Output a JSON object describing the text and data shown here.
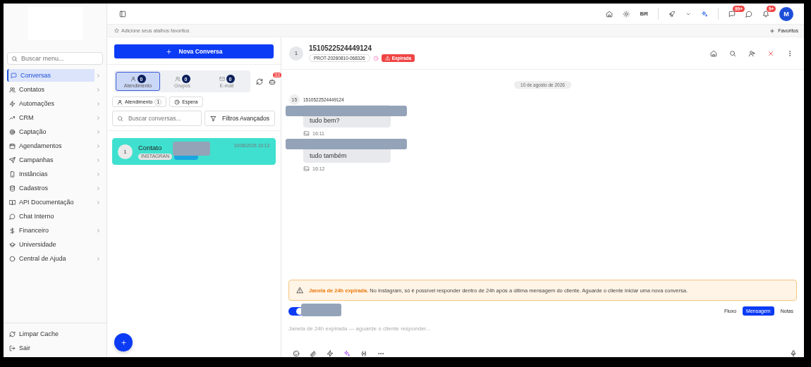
{
  "sidebar": {
    "search_placeholder": "Buscar menu...",
    "items": [
      {
        "label": "Conversas",
        "has_submenu": true,
        "selected": true
      },
      {
        "label": "Contatos",
        "has_submenu": true,
        "selected": false
      },
      {
        "label": "Automações",
        "has_submenu": true,
        "selected": false
      },
      {
        "label": "CRM",
        "has_submenu": true,
        "selected": false
      },
      {
        "label": "Captação",
        "has_submenu": true,
        "selected": false
      },
      {
        "label": "Agendamentos",
        "has_submenu": true,
        "selected": false
      },
      {
        "label": "Campanhas",
        "has_submenu": true,
        "selected": false
      },
      {
        "label": "Instâncias",
        "has_submenu": true,
        "selected": false
      },
      {
        "label": "Cadastros",
        "has_submenu": true,
        "selected": false
      },
      {
        "label": "API Documentação",
        "has_submenu": true,
        "selected": false
      },
      {
        "label": "Chat Interno",
        "has_submenu": false,
        "selected": false
      },
      {
        "label": "Financeiro",
        "has_submenu": true,
        "selected": false
      },
      {
        "label": "Universidade",
        "has_submenu": false,
        "selected": false
      },
      {
        "label": "Central de Ajuda",
        "has_submenu": true,
        "selected": false
      }
    ],
    "footer": [
      {
        "label": "Limpar Cache"
      },
      {
        "label": "Sair"
      }
    ]
  },
  "topbar": {
    "language": "BR",
    "chat_badge": "99+",
    "notification_badge": "9+",
    "avatar": "M"
  },
  "favorites": {
    "hint": "Adicione seus atalhos favoritos",
    "button": "Favoritos"
  },
  "conversations": {
    "new_button": "Nova Conversa",
    "tabs": [
      {
        "label": "Atendimento",
        "count": "0",
        "selected": true
      },
      {
        "label": "Grupos",
        "count": "0",
        "selected": false
      },
      {
        "label": "E-mail",
        "count": "0",
        "selected": false
      }
    ],
    "bot_badge": "33",
    "filters": [
      {
        "label": "Atendimento",
        "count": "1"
      },
      {
        "label": "Espera"
      }
    ],
    "search_placeholder": "Buscar conversas...",
    "advanced_filters": "Filtros Avançados",
    "items": [
      {
        "avatar": "1",
        "name": "Contato",
        "time": "10/08/2026 16:13",
        "channel": "INSTAGRAN",
        "selected": true
      }
    ]
  },
  "chat": {
    "avatar": "1",
    "title": "1510522524449124",
    "protocol": "PROT-20260810-068326",
    "status": "Expirada",
    "date": "10 de agosto de 2026",
    "sender_avatar": "15",
    "sender": "1510522524449124",
    "messages": [
      {
        "text": "tudo bem?",
        "time": "16:11"
      },
      {
        "text": "tudo também",
        "time": "16:12"
      }
    ],
    "alert": "**Janela de 24h expirada.** No Instagram, só é possível responder dentro de 24h após a última mensagem do cliente. Aguarde o cliente iniciar uma nova conversa.",
    "toggle_on": true,
    "modes": [
      {
        "label": "Fluxo",
        "selected": false
      },
      {
        "label": "Mensagem",
        "selected": true
      },
      {
        "label": "Notas",
        "selected": false
      }
    ],
    "composer_placeholder": "Janela de 24h expirada — aguarde o cliente responder..."
  }
}
